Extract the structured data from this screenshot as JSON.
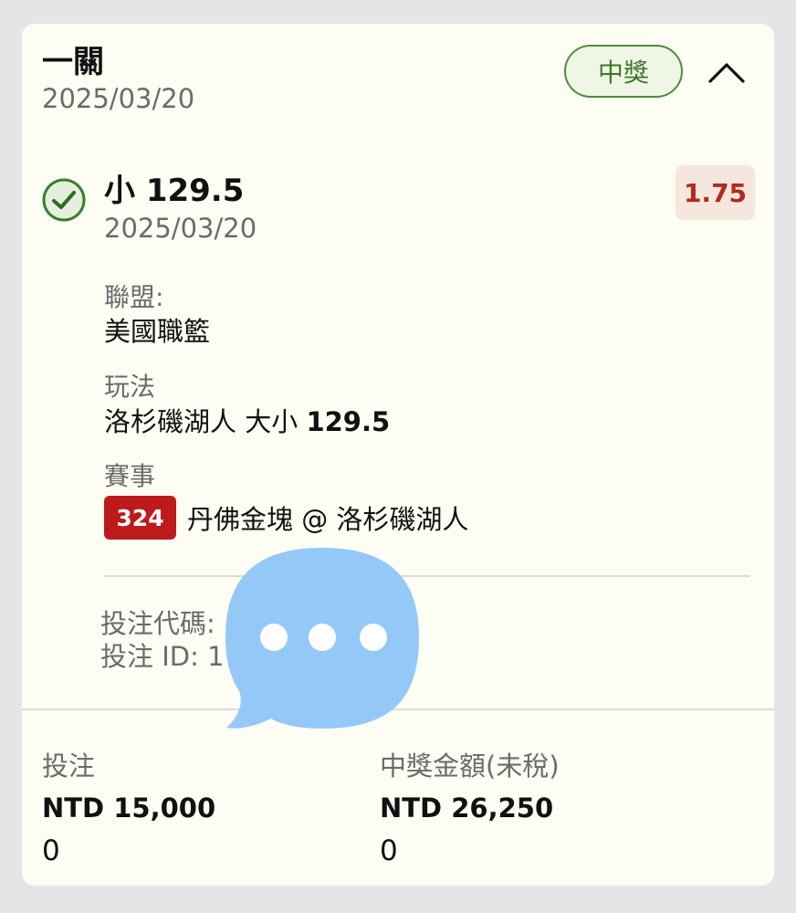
{
  "header": {
    "bet_type": "一關",
    "date": "2025/03/20",
    "status": "中獎"
  },
  "selection": {
    "title": "小 129.5",
    "date": "2025/03/20",
    "odds": "1.75"
  },
  "details": {
    "league_label": "聯盟:",
    "league_value": "美國職籃",
    "market_label": "玩法",
    "market_value_prefix": "洛杉磯湖人 大小",
    "market_value_line": "129.5",
    "event_label": "賽事",
    "event_number": "324",
    "event_name": "丹佛金塊 @ 洛杉磯湖人"
  },
  "codes": {
    "bet_code": "投注代碼:",
    "bet_id": "投注 ID: 1"
  },
  "footer": {
    "stake_label": "投注",
    "stake_value": "NTD 15,000",
    "stake_sub": "0",
    "payout_label": "中獎金額(未稅)",
    "payout_value": "NTD 26,250",
    "payout_sub": "0"
  },
  "icons": {
    "status_check": "check-circle-icon",
    "collapse": "chevron-up-icon",
    "overlay": "chat-bubble-icon"
  },
  "colors": {
    "win_green": "#3b7a2a",
    "odds_red": "#b22a1f",
    "event_badge_red": "#bd1b1b",
    "card_bg": "#fefdf4",
    "bubble_blue": "#94c9f7"
  }
}
